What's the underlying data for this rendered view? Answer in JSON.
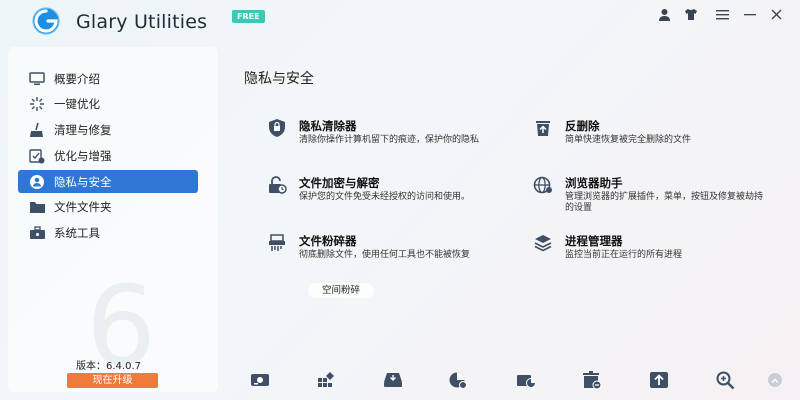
{
  "app": {
    "title": "Glary Utilities",
    "badge": "FREE"
  },
  "titlebar_icons": [
    "user-icon",
    "skin-icon",
    "menu-icon",
    "minimize-icon",
    "close-icon"
  ],
  "sidebar": {
    "items": [
      {
        "label": "概要介绍",
        "icon": "monitor-icon",
        "active": false
      },
      {
        "label": "一键优化",
        "icon": "sparkle-icon",
        "active": false
      },
      {
        "label": "清理与修复",
        "icon": "broom-icon",
        "active": false
      },
      {
        "label": "优化与增强",
        "icon": "optimize-icon",
        "active": false
      },
      {
        "label": "隐私与安全",
        "icon": "privacy-icon",
        "active": true
      },
      {
        "label": "文件文件夹",
        "icon": "folder-icon",
        "active": false
      },
      {
        "label": "系统工具",
        "icon": "toolbox-icon",
        "active": false
      }
    ],
    "version_label": "版本：6.4.0.7",
    "upgrade_label": "现在升级",
    "watermark": "6"
  },
  "main": {
    "section_title": "隐私与安全",
    "tools": [
      {
        "name": "隐私清除器",
        "desc": "清除你操作计算机留下的痕迹，保护你的隐私",
        "icon": "shield-icon"
      },
      {
        "name": "反删除",
        "desc": "简单快速恢复被完全删除的文件",
        "icon": "undelete-icon"
      },
      {
        "name": "文件加密与解密",
        "desc": "保护您的文件免受未经授权的访问和使用。",
        "icon": "lock-icon"
      },
      {
        "name": "浏览器助手",
        "desc": "管理浏览器的扩展插件，菜单，按钮及修复被劫持的设置",
        "icon": "globe-icon"
      },
      {
        "name": "文件粉碎器",
        "desc": "彻底删除文件，使用任何工具也不能被恢复",
        "icon": "shredder-icon"
      },
      {
        "name": "进程管理器",
        "desc": "监控当前正在运行的所有进程",
        "icon": "layers-icon"
      }
    ],
    "sub_button": "空间粉碎"
  },
  "colors": {
    "accent": "#2f77d5",
    "upgrade": "#f07a3c",
    "badge": "#3ec7b4",
    "icon": "#3f4f66"
  }
}
